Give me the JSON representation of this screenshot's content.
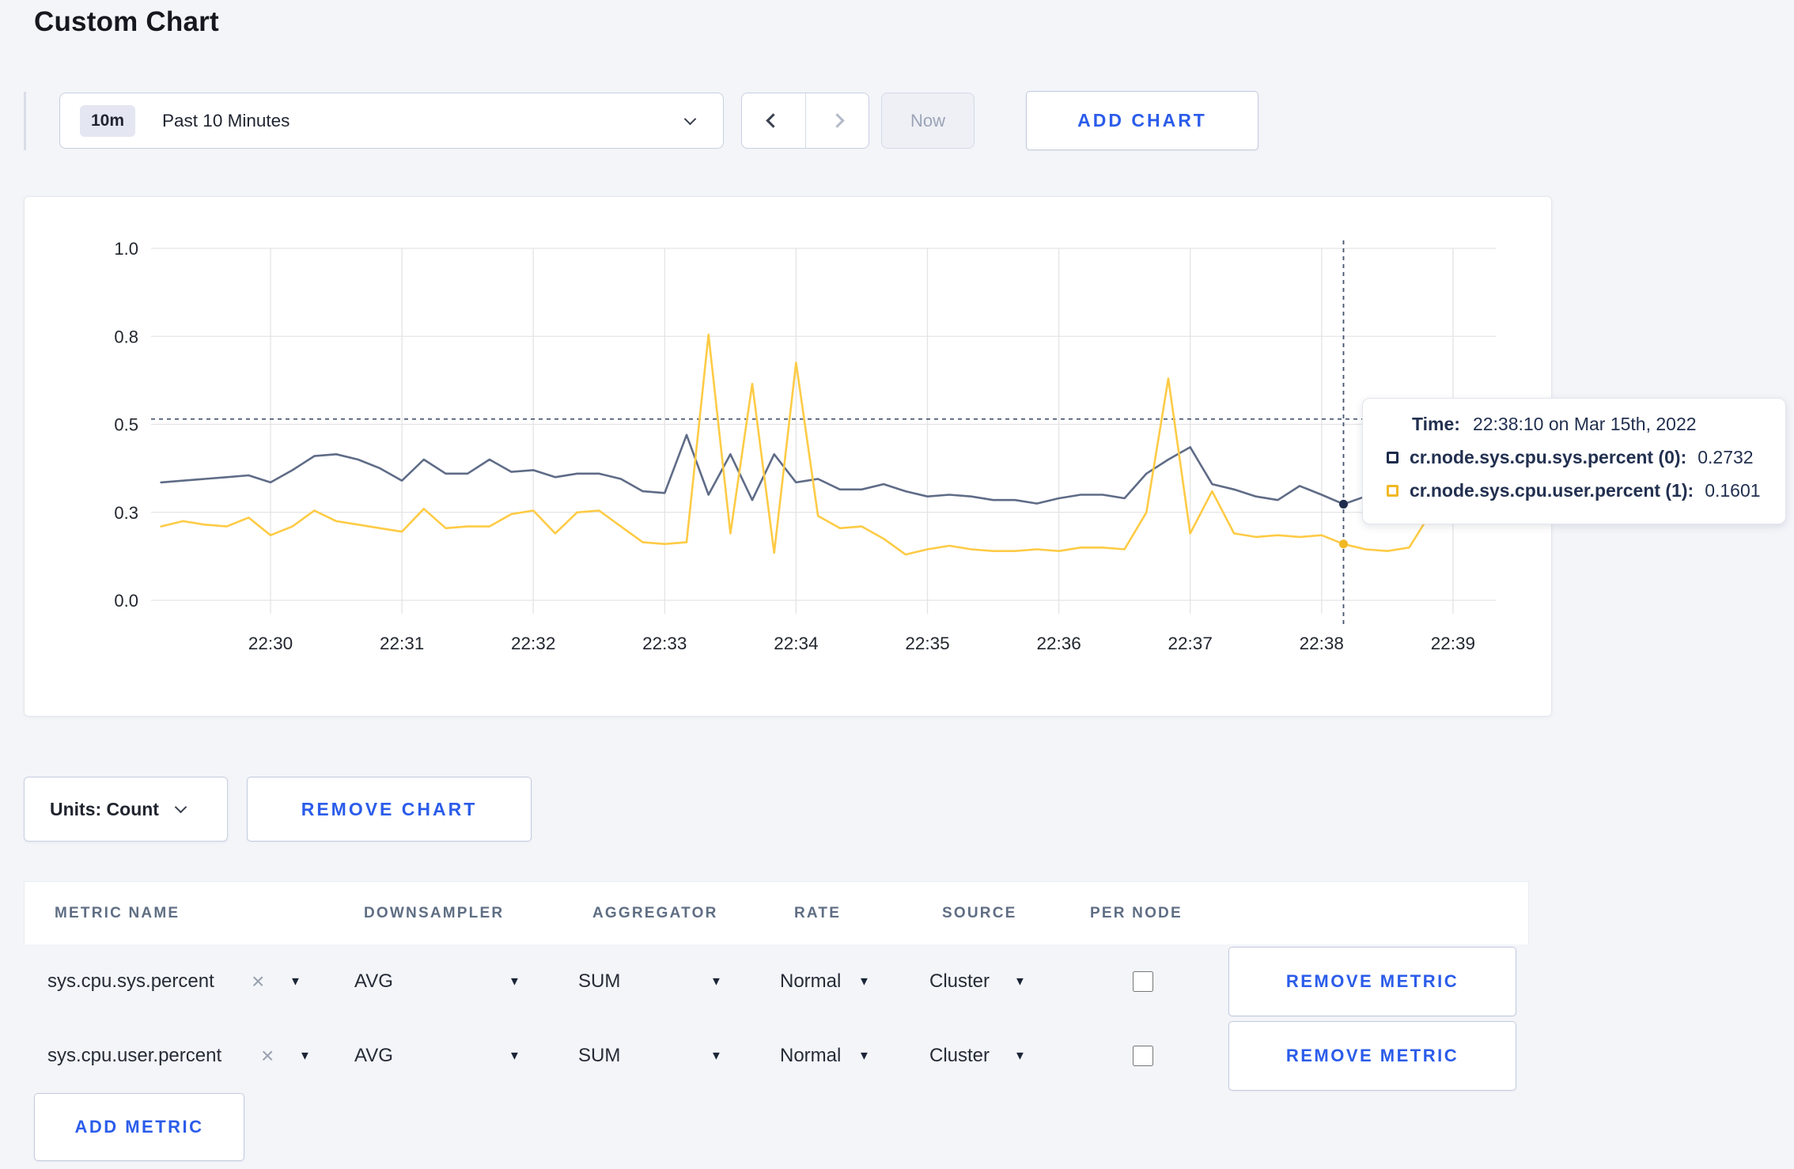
{
  "page": {
    "title": "Custom Chart"
  },
  "toolbar": {
    "time_badge": "10m",
    "time_label": "Past 10 Minutes",
    "now_label": "Now",
    "add_chart_label": "ADD CHART"
  },
  "chart_controls": {
    "units_label": "Units: Count",
    "remove_chart_label": "REMOVE CHART"
  },
  "chart_data": {
    "type": "line",
    "title": "",
    "xlabel": "",
    "ylabel": "",
    "x_tick_labels": [
      "22:30",
      "22:31",
      "22:32",
      "22:33",
      "22:34",
      "22:35",
      "22:36",
      "22:37",
      "22:38",
      "22:39"
    ],
    "y_axis": {
      "range": [
        0,
        1.0
      ],
      "ticks": [
        0,
        0.25,
        0.5,
        0.75,
        1.0
      ],
      "tick_labels": [
        "0.0",
        "0.3",
        "0.5",
        "0.8",
        "1.0"
      ],
      "grid": true
    },
    "start_time": "22:29:10",
    "interval_seconds": 10,
    "series": [
      {
        "name": "cr.node.sys.cpu.sys.percent (0)",
        "color": "#5f6c87",
        "swatch": "#1d2c4c",
        "values": [
          0.335,
          0.34,
          0.345,
          0.35,
          0.355,
          0.335,
          0.37,
          0.41,
          0.415,
          0.4,
          0.375,
          0.34,
          0.4,
          0.36,
          0.36,
          0.4,
          0.365,
          0.37,
          0.35,
          0.36,
          0.36,
          0.345,
          0.31,
          0.305,
          0.47,
          0.3,
          0.415,
          0.285,
          0.415,
          0.335,
          0.345,
          0.315,
          0.315,
          0.33,
          0.31,
          0.295,
          0.3,
          0.295,
          0.285,
          0.285,
          0.275,
          0.29,
          0.3,
          0.3,
          0.29,
          0.36,
          0.4,
          0.435,
          0.33,
          0.315,
          0.295,
          0.285,
          0.325,
          0.3,
          0.2732,
          0.295,
          0.3,
          0.31,
          0.3,
          0.315,
          0.3
        ]
      },
      {
        "name": "cr.node.sys.cpu.user.percent (1)",
        "color": "#fecb45",
        "swatch": "#f1b825",
        "values": [
          0.21,
          0.225,
          0.215,
          0.21,
          0.235,
          0.185,
          0.21,
          0.255,
          0.225,
          0.215,
          0.205,
          0.195,
          0.26,
          0.205,
          0.21,
          0.21,
          0.245,
          0.255,
          0.19,
          0.25,
          0.255,
          0.21,
          0.165,
          0.16,
          0.165,
          0.755,
          0.19,
          0.615,
          0.135,
          0.675,
          0.24,
          0.205,
          0.21,
          0.175,
          0.13,
          0.145,
          0.155,
          0.145,
          0.14,
          0.14,
          0.145,
          0.14,
          0.15,
          0.15,
          0.145,
          0.25,
          0.63,
          0.19,
          0.31,
          0.19,
          0.18,
          0.185,
          0.18,
          0.185,
          0.1601,
          0.145,
          0.14,
          0.15,
          0.25,
          0.3,
          0.235
        ]
      }
    ],
    "hover": {
      "index": 54,
      "time": "22:38:10",
      "values": [
        0.2732,
        0.1601
      ]
    },
    "threshold_value": 0.515,
    "legend_position": "tooltip",
    "gridline_color": "#e4e4e4",
    "crosshair_color": "#44546e"
  },
  "tooltip": {
    "time_label": "Time:",
    "time_value": "22:38:10 on Mar 15th, 2022",
    "rows": [
      {
        "label": "cr.node.sys.cpu.sys.percent (0):",
        "value": "0.2732",
        "color": "#1d2c4c"
      },
      {
        "label": "cr.node.sys.cpu.user.percent (1):",
        "value": "0.1601",
        "color": "#f1b825"
      }
    ]
  },
  "metrics_table": {
    "headers": [
      "METRIC NAME",
      "DOWNSAMPLER",
      "AGGREGATOR",
      "RATE",
      "SOURCE",
      "PER NODE"
    ],
    "rows": [
      {
        "metric_name": "sys.cpu.sys.percent",
        "downsampler": "AVG",
        "aggregator": "SUM",
        "rate": "Normal",
        "source": "Cluster",
        "per_node_checked": false,
        "remove_label": "REMOVE METRIC"
      },
      {
        "metric_name": "sys.cpu.user.percent",
        "downsampler": "AVG",
        "aggregator": "SUM",
        "rate": "Normal",
        "source": "Cluster",
        "per_node_checked": false,
        "remove_label": "REMOVE METRIC"
      }
    ],
    "add_metric_label": "ADD METRIC"
  },
  "colors": {
    "accent_blue": "#2b5cea",
    "page_bg": "#f3f5f9",
    "text_dark": "#20242e",
    "header_slate": "#5f6e84"
  }
}
